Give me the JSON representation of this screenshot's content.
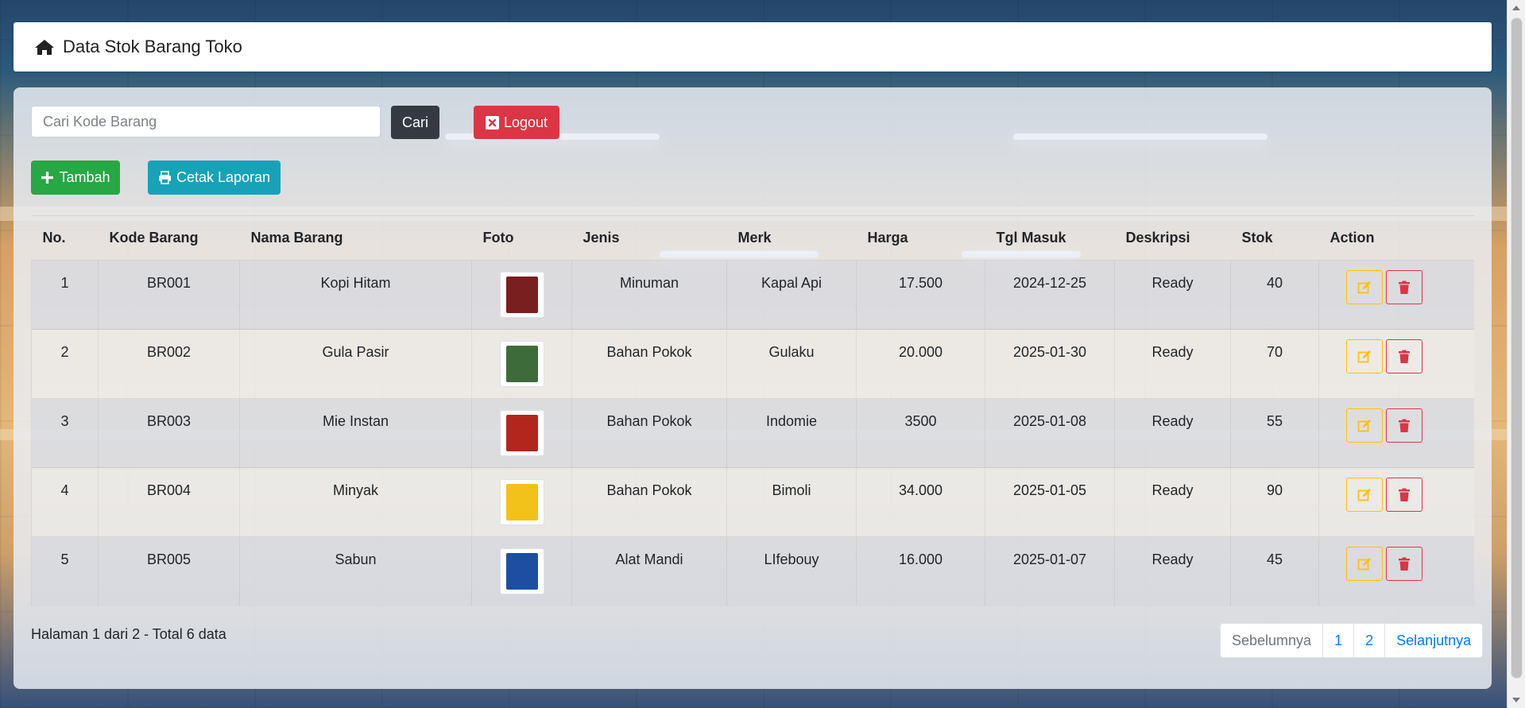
{
  "navbar": {
    "title": "Data Stok Barang Toko",
    "icon": "home-icon"
  },
  "search": {
    "placeholder": "Cari Kode Barang",
    "value": "",
    "button_label": "Cari"
  },
  "buttons": {
    "logout": "Logout",
    "add": "Tambah",
    "print": "Cetak Laporan"
  },
  "table": {
    "headers": [
      "No.",
      "Kode Barang",
      "Nama Barang",
      "Foto",
      "Jenis",
      "Merk",
      "Harga",
      "Tgl Masuk",
      "Deskripsi",
      "Stok",
      "Action"
    ],
    "rows": [
      {
        "no": "1",
        "kode": "BR001",
        "nama": "Kopi Hitam",
        "foto": "product-photo",
        "jenis": "Minuman",
        "merk": "Kapal Api",
        "harga": "17.500",
        "tgl": "2024-12-25",
        "deskripsi": "Ready",
        "stok": "40"
      },
      {
        "no": "2",
        "kode": "BR002",
        "nama": "Gula Pasir",
        "foto": "product-photo",
        "jenis": "Bahan Pokok",
        "merk": "Gulaku",
        "harga": "20.000",
        "tgl": "2025-01-30",
        "deskripsi": "Ready",
        "stok": "70"
      },
      {
        "no": "3",
        "kode": "BR003",
        "nama": "Mie Instan",
        "foto": "product-photo",
        "jenis": "Bahan Pokok",
        "merk": "Indomie",
        "harga": "3500",
        "tgl": "2025-01-08",
        "deskripsi": "Ready",
        "stok": "55"
      },
      {
        "no": "4",
        "kode": "BR004",
        "nama": "Minyak",
        "foto": "product-photo",
        "jenis": "Bahan Pokok",
        "merk": "Bimoli",
        "harga": "34.000",
        "tgl": "2025-01-05",
        "deskripsi": "Ready",
        "stok": "90"
      },
      {
        "no": "5",
        "kode": "BR005",
        "nama": "Sabun",
        "foto": "product-photo",
        "jenis": "Alat Mandi",
        "merk": "LIfebouy",
        "harga": "16.000",
        "tgl": "2025-01-07",
        "deskripsi": "Ready",
        "stok": "45"
      }
    ]
  },
  "footer": {
    "info": "Halaman 1 dari 2 - Total 6 data",
    "pagination": {
      "prev": "Sebelumnya",
      "pages": [
        "1",
        "2"
      ],
      "next": "Selanjutnya"
    }
  },
  "colors": {
    "success": "#28a745",
    "info": "#17a2b8",
    "danger": "#dc3545",
    "warning": "#ffc107",
    "dark": "#343a40",
    "link": "#007bff"
  },
  "product_thumbs": [
    "#7a1f1f",
    "#3e6b3a",
    "#b3261e",
    "#f2c21b",
    "#1c4fa1"
  ]
}
